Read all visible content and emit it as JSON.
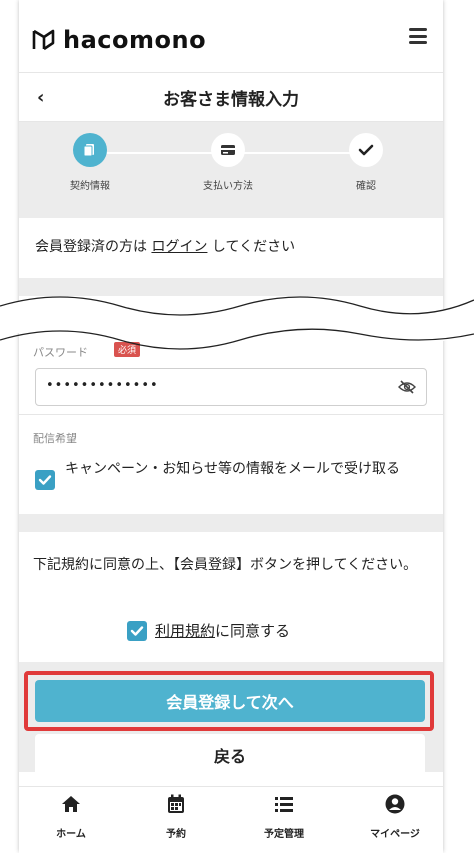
{
  "header": {
    "logo_text": "hacomono"
  },
  "titlebar": {
    "back": "‹",
    "title": "お客さま情報入力"
  },
  "stepper": {
    "steps": [
      {
        "label": "契約情報",
        "state": "active"
      },
      {
        "label": "支払い方法",
        "state": "pending"
      },
      {
        "label": "確認",
        "state": "done"
      }
    ]
  },
  "login": {
    "prefix": "会員登録済の方は ",
    "link": "ログイン",
    "suffix": " してください"
  },
  "password": {
    "label": "パスワード",
    "required": "必須",
    "value": "•••••••••••••"
  },
  "mail": {
    "label": "配信希望",
    "option": "キャンペーン・お知らせ等の情報をメールで受け取る",
    "checked": true
  },
  "terms": {
    "instruction": "下記規約に同意の上、【会員登録】ボタンを押してください。",
    "link": "利用規約",
    "agree_suffix": "に同意する",
    "checked": true
  },
  "buttons": {
    "register": "会員登録して次へ",
    "back": "戻る"
  },
  "tabbar": {
    "items": [
      {
        "label": "ホーム",
        "icon": "home-icon"
      },
      {
        "label": "予約",
        "icon": "calendar-icon"
      },
      {
        "label": "予定管理",
        "icon": "list-icon"
      },
      {
        "label": "マイページ",
        "icon": "user-icon"
      }
    ]
  },
  "colors": {
    "accent": "#4fb3cf",
    "highlight": "#e03a3a",
    "required": "#d9534f"
  }
}
